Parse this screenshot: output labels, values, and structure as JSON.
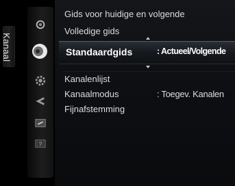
{
  "sidebar": {
    "tab_label": "Kanaal"
  },
  "icons": [
    {
      "name": "picture-icon",
      "active": false
    },
    {
      "name": "channel-icon",
      "active": true
    },
    {
      "name": "setup-icon",
      "active": false
    },
    {
      "name": "input-icon",
      "active": false
    },
    {
      "name": "application-icon",
      "active": false
    },
    {
      "name": "support-icon",
      "active": false
    }
  ],
  "menu": {
    "items": [
      {
        "label": "Gids voor huidige en volgende",
        "value": ""
      },
      {
        "label": "Volledige gids",
        "value": ""
      },
      {
        "label": "Standaardgids",
        "value": ": Actueel/Volgende",
        "selected": true
      },
      {
        "label": "Kanalenlijst",
        "value": ""
      },
      {
        "label": "Kanaalmodus",
        "value": ": Toegev. Kanalen"
      },
      {
        "label": "Fijnafstemming",
        "value": ""
      }
    ]
  },
  "colors": {
    "background": "#000000",
    "text": "#dcdcdc",
    "selected_text": "#ffffff"
  }
}
